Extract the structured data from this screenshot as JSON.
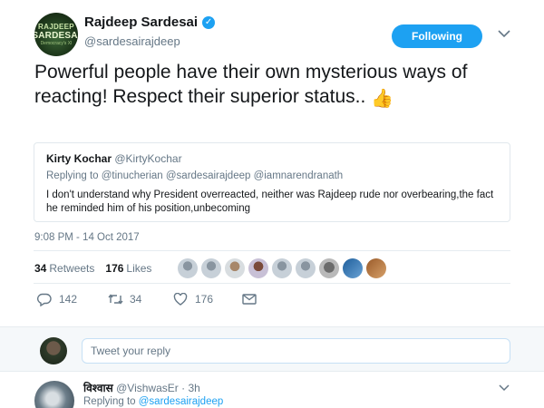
{
  "author": {
    "name": "Rajdeep Sardesai",
    "handle": "@sardesairajdeep",
    "avatar_line1": "RAJDEEP",
    "avatar_line2": "SARDESAI",
    "avatar_line3": "Democracy's XI"
  },
  "follow_label": "Following",
  "tweet": {
    "text": "Powerful people have their own mysterious ways of reacting! Respect their superior status..",
    "emoji": "👍"
  },
  "quoted": {
    "name": "Kirty Kochar",
    "handle": "@KirtyKochar",
    "replying_prefix": "Replying to",
    "replying_to": "@tinucherian @sardesairajdeep @iamnarendranath",
    "text": "I don't understand why President overreacted, neither was Rajdeep rude nor overbearing,the fact he reminded him of his position,unbecoming"
  },
  "timestamp": "9:08 PM - 14 Oct 2017",
  "stats": {
    "retweets_count": "34",
    "retweets_label": "Retweets",
    "likes_count": "176",
    "likes_label": "Likes"
  },
  "actions": {
    "reply_count": "142",
    "retweet_count": "34",
    "like_count": "176"
  },
  "reply_box": {
    "placeholder": "Tweet your reply"
  },
  "next_reply": {
    "name": "विश्वास",
    "handle": "@VishwasEr",
    "time": "· 3h",
    "replying_prefix": "Replying to",
    "replying_to": "@sardesairajdeep"
  },
  "colors": {
    "accent": "#1da1f2",
    "muted": "#657786",
    "border": "#e1e8ed",
    "text": "#14171a"
  }
}
